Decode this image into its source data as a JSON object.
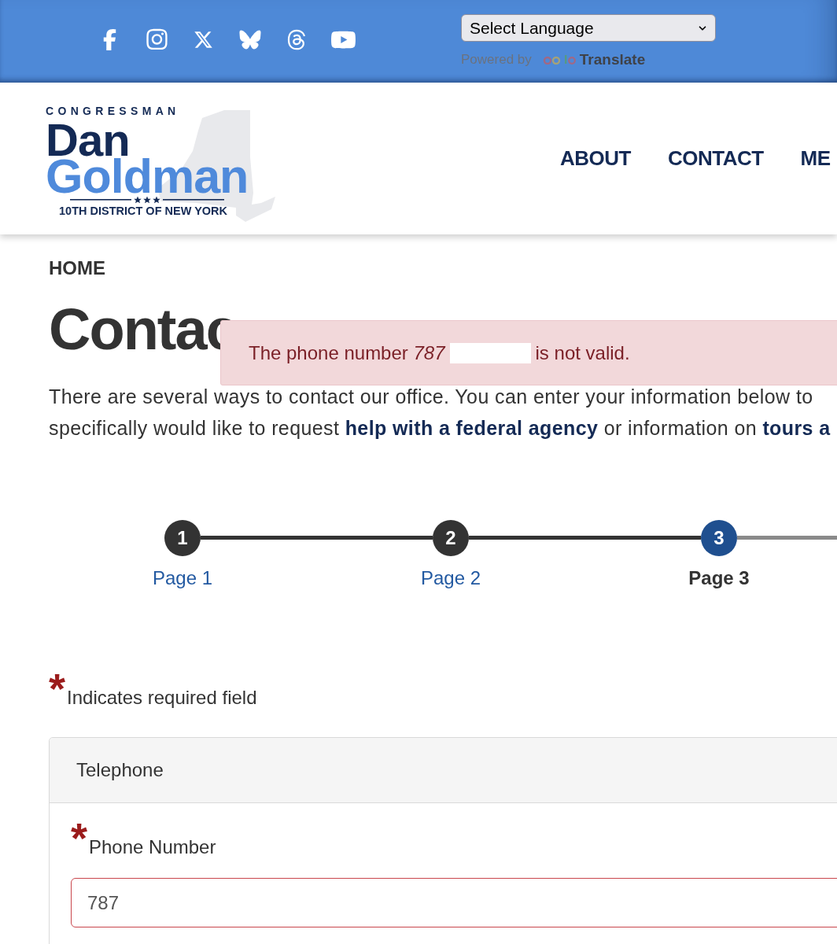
{
  "top_bar": {
    "social_links": [
      {
        "kind": "facebook"
      },
      {
        "kind": "instagram"
      },
      {
        "kind": "x"
      },
      {
        "kind": "bluesky"
      },
      {
        "kind": "threads"
      },
      {
        "kind": "youtube"
      }
    ],
    "language_select": {
      "value": "Select Language"
    },
    "powered_by": {
      "prefix": "Powered by",
      "product": "Translate"
    }
  },
  "header": {
    "logo": {
      "eyebrow": "CONGRESSMAN",
      "first_name": "Dan",
      "last_name": "Goldman",
      "tagline": "10TH DISTRICT OF NEW YORK"
    },
    "nav": [
      {
        "label": "ABOUT"
      },
      {
        "label": "CONTACT"
      },
      {
        "label": "ME"
      }
    ]
  },
  "breadcrumb": [
    {
      "label": "HOME"
    }
  ],
  "page_title": "Contac",
  "alert": {
    "message_start": "The phone number *787*",
    "redacted": true,
    "message_end": "is not valid."
  },
  "intro": {
    "lines": [
      [
        {
          "kind": "text",
          "text": "There are several ways to contact our office. You can enter your information below to"
        }
      ],
      [
        {
          "kind": "text",
          "text": "specifically would like to request "
        },
        {
          "kind": "link",
          "text": "help with a federal agency"
        },
        {
          "kind": "text",
          "text": " or information on "
        },
        {
          "kind": "link",
          "text": "tours a"
        }
      ]
    ]
  },
  "steps": [
    {
      "number": "1",
      "label": "Page 1",
      "completed": true,
      "selected": false
    },
    {
      "number": "2",
      "label": "Page 2",
      "completed": true,
      "selected": false
    },
    {
      "number": "3",
      "label": "Page 3",
      "completed": false,
      "selected": true
    }
  ],
  "required_note": {
    "mark": "*",
    "text": "Indicates required field"
  },
  "fieldset": {
    "legend": "Telephone",
    "fields": [
      {
        "label": "Phone Number",
        "required": true,
        "mark": "*",
        "value": "787",
        "invalid": true
      }
    ]
  }
}
